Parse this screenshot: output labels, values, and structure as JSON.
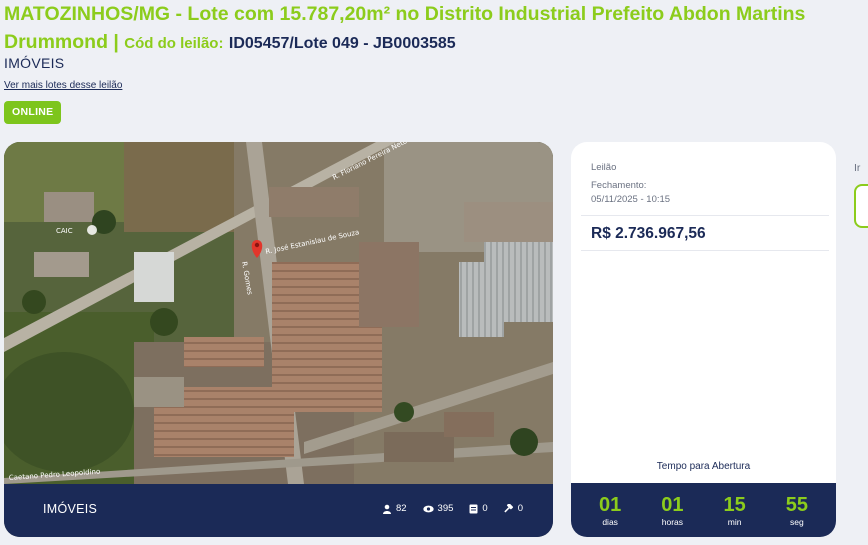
{
  "lot": {
    "title": "MATOZINHOS/MG - Lote com 15.787,20m² no Distrito Industrial Prefeito Abdon Martins Drummond |",
    "code_label": "Cód do leilão:",
    "code_value": "ID05457/Lote 049 - JB0003585",
    "category": "IMÓVEIS",
    "more_lots_link": "Ver mais lotes desse leilão",
    "status_badge": "ONLINE"
  },
  "photo": {
    "map_labels": {
      "street_1": "R. Floriano Pereira Neto",
      "street_2": "R. José Estanislau de Souza",
      "street_3": "R. Gomes",
      "street_4": "Caetano Pedro Leopoldino",
      "place": "CAIC"
    },
    "footer": {
      "category": "IMÓVEIS",
      "stats": {
        "bidders": "82",
        "views": "395",
        "documents": "0",
        "bids": "0"
      }
    }
  },
  "auction": {
    "type": "Leilão",
    "closing_label": "Fechamento:",
    "closing_date": "05/11/2025 - 10:15",
    "price": "R$ 2.736.967,56",
    "countdown_title": "Tempo para Abertura",
    "countdown": [
      {
        "value": "01",
        "label": "dias"
      },
      {
        "value": "01",
        "label": "horas"
      },
      {
        "value": "15",
        "label": "min"
      },
      {
        "value": "55",
        "label": "seg"
      }
    ]
  },
  "side": {
    "label": "Ir"
  },
  "colors": {
    "accent_green": "#8ccc1c",
    "navy": "#1b2a57",
    "badge_green": "#7dc51c",
    "background": "#eef0f5"
  }
}
